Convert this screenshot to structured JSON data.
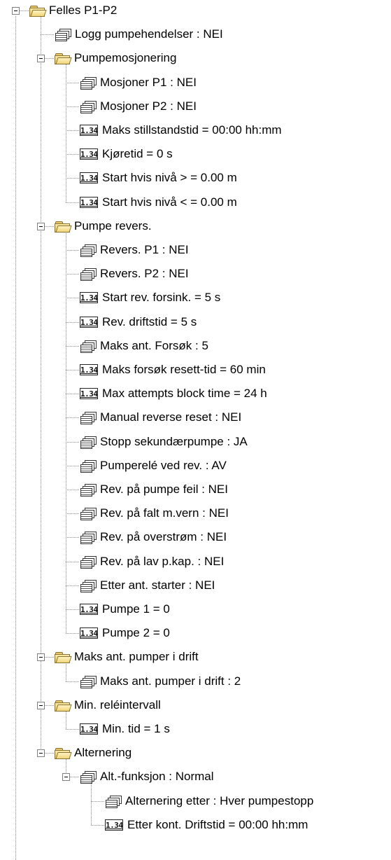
{
  "tree": {
    "nodes": [
      {
        "label": "Felles P1-P2",
        "icon": "folder-icon",
        "level": 0,
        "expanded": true
      },
      {
        "label": "Logg pumpehendelser : NEI",
        "icon": "value-icon",
        "level": 1
      },
      {
        "label": "Pumpemosjonering",
        "icon": "folder-icon",
        "level": 1,
        "expanded": true
      },
      {
        "label": "Mosjoner P1 : NEI",
        "icon": "value-icon",
        "level": 2
      },
      {
        "label": "Mosjoner P2 : NEI",
        "icon": "value-icon",
        "level": 2
      },
      {
        "label": "Maks stillstandstid = 00:00 hh:mm",
        "icon": "numeric-icon",
        "level": 2
      },
      {
        "label": "Kjøretid = 0 s",
        "icon": "numeric-icon",
        "level": 2
      },
      {
        "label": "Start hvis nivå > = 0.00 m",
        "icon": "numeric-icon",
        "level": 2
      },
      {
        "label": "Start hvis nivå < = 0.00 m",
        "icon": "numeric-icon",
        "level": 2
      },
      {
        "label": "Pumpe revers.",
        "icon": "folder-icon",
        "level": 1,
        "expanded": true
      },
      {
        "label": "Revers. P1 : NEI",
        "icon": "value-icon",
        "level": 2
      },
      {
        "label": "Revers. P2 : NEI",
        "icon": "value-icon",
        "level": 2
      },
      {
        "label": "Start rev. forsink. = 5 s",
        "icon": "numeric-icon",
        "level": 2
      },
      {
        "label": "Rev. driftstid = 5 s",
        "icon": "numeric-icon",
        "level": 2
      },
      {
        "label": "Maks ant. Forsøk : 5",
        "icon": "value-icon",
        "level": 2
      },
      {
        "label": "Maks forsøk resett-tid = 60 min",
        "icon": "numeric-icon",
        "level": 2
      },
      {
        "label": "Max attempts block time = 24 h",
        "icon": "numeric-icon",
        "level": 2
      },
      {
        "label": "Manual reverse reset : NEI",
        "icon": "value-icon",
        "level": 2
      },
      {
        "label": "Stopp sekundærpumpe : JA",
        "icon": "value-icon",
        "level": 2
      },
      {
        "label": "Pumperelé ved rev. : AV",
        "icon": "value-icon",
        "level": 2
      },
      {
        "label": "Rev. på pumpe feil : NEI",
        "icon": "value-icon",
        "level": 2
      },
      {
        "label": "Rev. på falt m.vern : NEI",
        "icon": "value-icon",
        "level": 2
      },
      {
        "label": "Rev. på overstrøm : NEI",
        "icon": "value-icon",
        "level": 2
      },
      {
        "label": "Rev. på lav p.kap. : NEI",
        "icon": "value-icon",
        "level": 2
      },
      {
        "label": "Etter ant. starter : NEI",
        "icon": "value-icon",
        "level": 2
      },
      {
        "label": "Pumpe 1 = 0",
        "icon": "numeric-icon",
        "level": 2
      },
      {
        "label": "Pumpe 2 = 0",
        "icon": "numeric-icon",
        "level": 2
      },
      {
        "label": "Maks ant. pumper i drift",
        "icon": "folder-icon",
        "level": 1,
        "expanded": true
      },
      {
        "label": "Maks ant. pumper i drift : 2",
        "icon": "value-icon",
        "level": 2
      },
      {
        "label": "Min. reléintervall",
        "icon": "folder-icon",
        "level": 1,
        "expanded": true
      },
      {
        "label": "Min. tid = 1 s",
        "icon": "numeric-icon",
        "level": 2
      },
      {
        "label": "Alternering",
        "icon": "folder-icon",
        "level": 1,
        "expanded": true
      },
      {
        "label": "Alt.-funksjon : Normal",
        "icon": "value-icon",
        "level": 2,
        "expanded": true
      },
      {
        "label": "Alternering etter : Hver pumpestopp",
        "icon": "value-icon",
        "level": 3
      },
      {
        "label": "Etter kont. Driftstid = 00:00 hh:mm",
        "icon": "numeric-icon",
        "level": 3
      }
    ],
    "numeric_icon_text": "1.34"
  }
}
